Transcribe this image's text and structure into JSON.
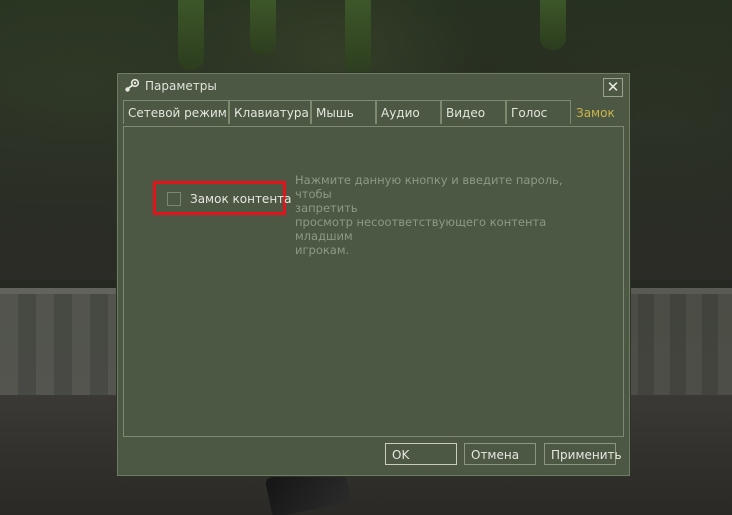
{
  "window": {
    "title": "Параметры"
  },
  "tabs": [
    {
      "label": "Сетевой режим"
    },
    {
      "label": "Клавиатура"
    },
    {
      "label": "Мышь"
    },
    {
      "label": "Аудио"
    },
    {
      "label": "Видео"
    },
    {
      "label": "Голос"
    },
    {
      "label": "Замок"
    }
  ],
  "active_tab": "Замок",
  "content_lock": {
    "checkbox_label": "Замок контента",
    "checked": false,
    "description_lines": [
      "Нажмите данную кнопку и введите пароль, чтобы",
      "запретить",
      "просмотр несоответствующего контента младшим",
      "игрокам."
    ]
  },
  "buttons": {
    "ok": "OK",
    "cancel": "Отмена",
    "apply": "Применить"
  },
  "colors": {
    "dialog_bg": "#4c5844",
    "active_tab_text": "#c9b44c",
    "highlight": "#e0141a"
  },
  "icons": {
    "app": "steam-icon",
    "close": "close-icon"
  }
}
